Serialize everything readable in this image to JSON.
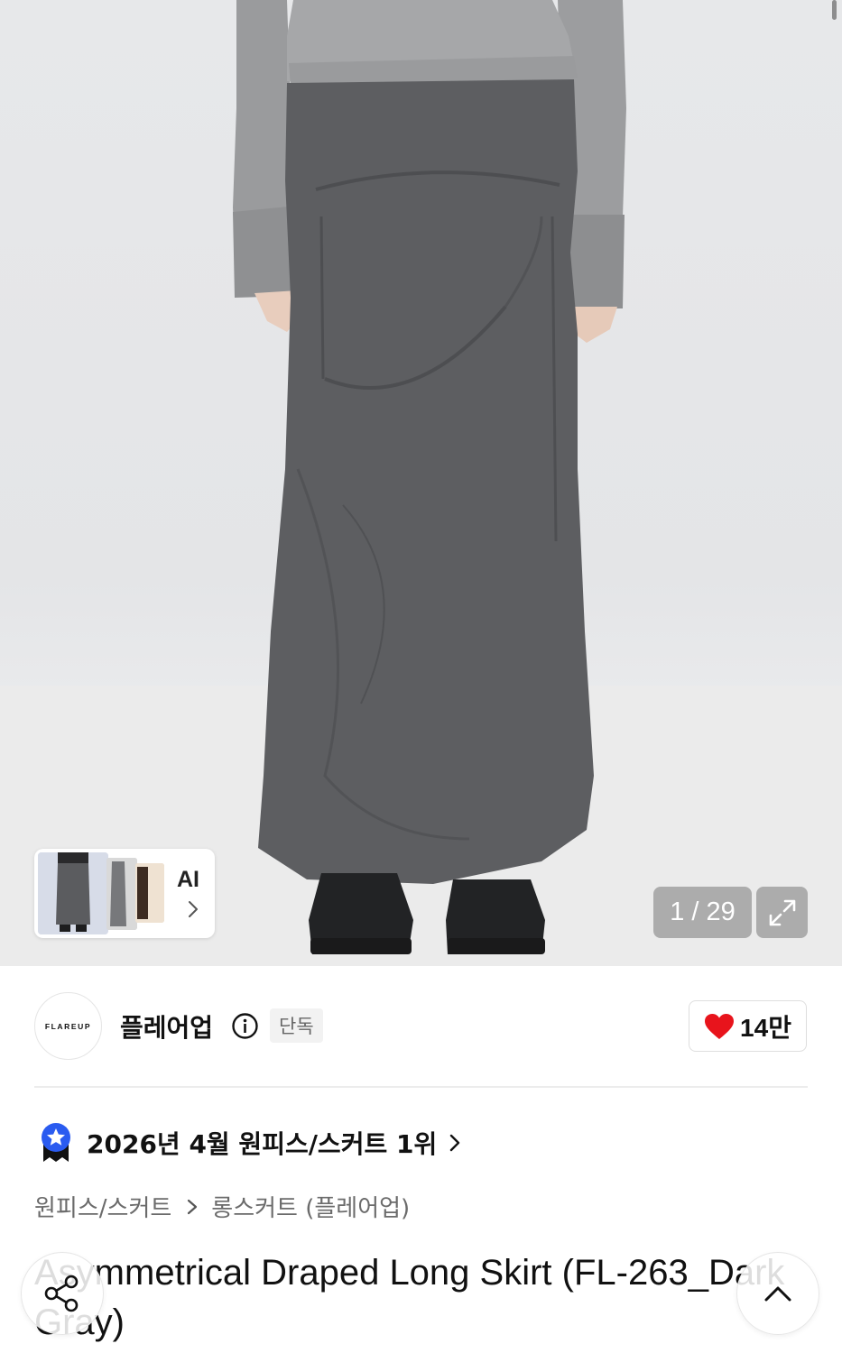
{
  "gallery": {
    "current": 1,
    "total": 29,
    "counter_text": "1 / 29",
    "ai_label": "AI"
  },
  "brand": {
    "logo_text": "FLAREUP",
    "name": "플레어업",
    "exclusive_badge": "단독",
    "like_count": "14만",
    "heart_color": "#e8141c"
  },
  "ranking": {
    "text": "2026년 4월 원피스/스커트 1위",
    "icon_color": "#2a5bf0"
  },
  "breadcrumb": {
    "level1": "원피스/스커트",
    "level2": "롱스커트 (플레어업)"
  },
  "product": {
    "title": "Asymmetrical Draped Long Skirt (FL-263_Dark Gray)"
  }
}
